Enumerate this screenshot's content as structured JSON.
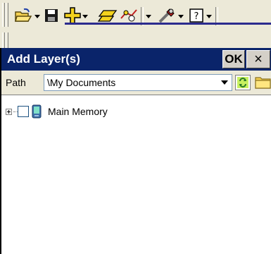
{
  "toolbar": {
    "icons": [
      "open-folder-icon",
      "save-icon",
      "add-layer-icon",
      "polygon-icon",
      "node-edit-icon",
      "tools-icon",
      "help-icon"
    ]
  },
  "dialog": {
    "title": "Add Layer(s)",
    "ok_label": "OK",
    "close_label": "×"
  },
  "pathbar": {
    "label": "Path",
    "value": "\\My Documents"
  },
  "tree": {
    "items": [
      {
        "label": "Main Memory",
        "icon": "pocket-pc-icon"
      }
    ]
  },
  "colors": {
    "titlebar": "#0a246a",
    "toolbar": "#ece9d8"
  }
}
